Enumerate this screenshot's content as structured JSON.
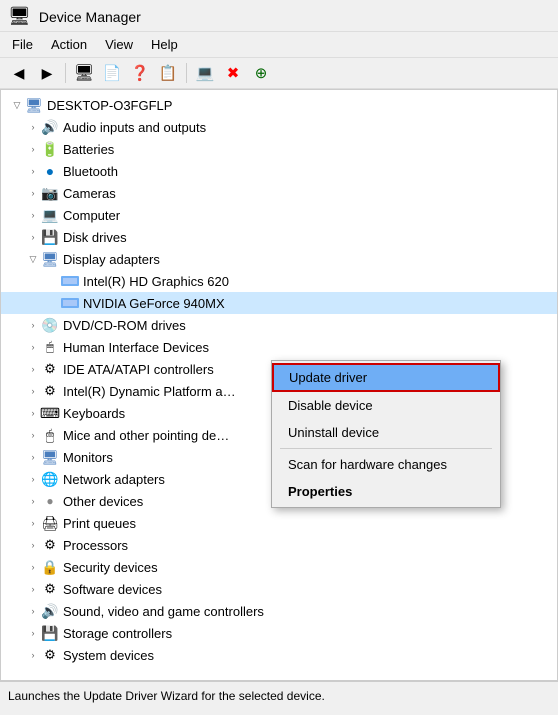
{
  "window": {
    "title": "Device Manager",
    "icon": "🖥"
  },
  "menubar": {
    "items": [
      "File",
      "Action",
      "View",
      "Help"
    ]
  },
  "toolbar": {
    "buttons": [
      {
        "name": "back-button",
        "icon": "◀",
        "label": "Back"
      },
      {
        "name": "forward-button",
        "icon": "▶",
        "label": "Forward"
      },
      {
        "name": "computer-button",
        "icon": "🖥",
        "label": "Computer"
      },
      {
        "name": "properties-button",
        "icon": "📄",
        "label": "Properties"
      },
      {
        "name": "help-button",
        "icon": "❓",
        "label": "Help"
      },
      {
        "name": "update-driver-button",
        "icon": "📋",
        "label": "Update Driver"
      },
      {
        "name": "disable-button",
        "icon": "💻",
        "label": "Disable"
      },
      {
        "name": "uninstall-button",
        "icon": "✖",
        "label": "Uninstall"
      },
      {
        "name": "scan-button",
        "icon": "⊕",
        "label": "Scan"
      }
    ]
  },
  "tree": {
    "root": {
      "label": "DESKTOP-O3FGFLP",
      "icon": "🖥",
      "expanded": true,
      "children": [
        {
          "label": "Audio inputs and outputs",
          "icon": "🔊",
          "expanded": false,
          "indent": 2
        },
        {
          "label": "Batteries",
          "icon": "🔋",
          "expanded": false,
          "indent": 2
        },
        {
          "label": "Bluetooth",
          "icon": "🔵",
          "expanded": false,
          "indent": 2
        },
        {
          "label": "Cameras",
          "icon": "📷",
          "expanded": false,
          "indent": 2
        },
        {
          "label": "Computer",
          "icon": "💻",
          "expanded": false,
          "indent": 2
        },
        {
          "label": "Disk drives",
          "icon": "💾",
          "expanded": false,
          "indent": 2
        },
        {
          "label": "Display adapters",
          "icon": "🖥",
          "expanded": true,
          "indent": 2
        },
        {
          "label": "Intel(R) HD Graphics 620",
          "icon": "GPU",
          "expanded": false,
          "indent": 3
        },
        {
          "label": "NVIDIA GeForce 940MX",
          "icon": "GPU",
          "expanded": false,
          "indent": 3,
          "selected": true
        },
        {
          "label": "DVD/CD-ROM drives",
          "icon": "💿",
          "expanded": false,
          "indent": 2
        },
        {
          "label": "Human Interface Devices",
          "icon": "🖱",
          "expanded": false,
          "indent": 2
        },
        {
          "label": "IDE ATA/ATAPI controllers",
          "icon": "⚙",
          "expanded": false,
          "indent": 2
        },
        {
          "label": "Intel(R) Dynamic Platform a…",
          "icon": "⚙",
          "expanded": false,
          "indent": 2
        },
        {
          "label": "Keyboards",
          "icon": "⌨",
          "expanded": false,
          "indent": 2
        },
        {
          "label": "Mice and other pointing de…",
          "icon": "🖱",
          "expanded": false,
          "indent": 2
        },
        {
          "label": "Monitors",
          "icon": "🖥",
          "expanded": false,
          "indent": 2
        },
        {
          "label": "Network adapters",
          "icon": "🌐",
          "expanded": false,
          "indent": 2
        },
        {
          "label": "Other devices",
          "icon": "❓",
          "expanded": false,
          "indent": 2
        },
        {
          "label": "Print queues",
          "icon": "🖨",
          "expanded": false,
          "indent": 2
        },
        {
          "label": "Processors",
          "icon": "⚙",
          "expanded": false,
          "indent": 2
        },
        {
          "label": "Security devices",
          "icon": "🔒",
          "expanded": false,
          "indent": 2
        },
        {
          "label": "Software devices",
          "icon": "⚙",
          "expanded": false,
          "indent": 2
        },
        {
          "label": "Sound, video and game controllers",
          "icon": "🔊",
          "expanded": false,
          "indent": 2
        },
        {
          "label": "Storage controllers",
          "icon": "💾",
          "expanded": false,
          "indent": 2
        },
        {
          "label": "System devices",
          "icon": "⚙",
          "expanded": false,
          "indent": 2
        }
      ]
    }
  },
  "context_menu": {
    "items": [
      {
        "label": "Update driver",
        "type": "highlighted"
      },
      {
        "label": "Disable device",
        "type": "normal"
      },
      {
        "label": "Uninstall device",
        "type": "normal"
      },
      {
        "label": "separator"
      },
      {
        "label": "Scan for hardware changes",
        "type": "normal"
      },
      {
        "label": "Properties",
        "type": "bold"
      }
    ]
  },
  "status_bar": {
    "text": "Launches the Update Driver Wizard for the selected device."
  }
}
